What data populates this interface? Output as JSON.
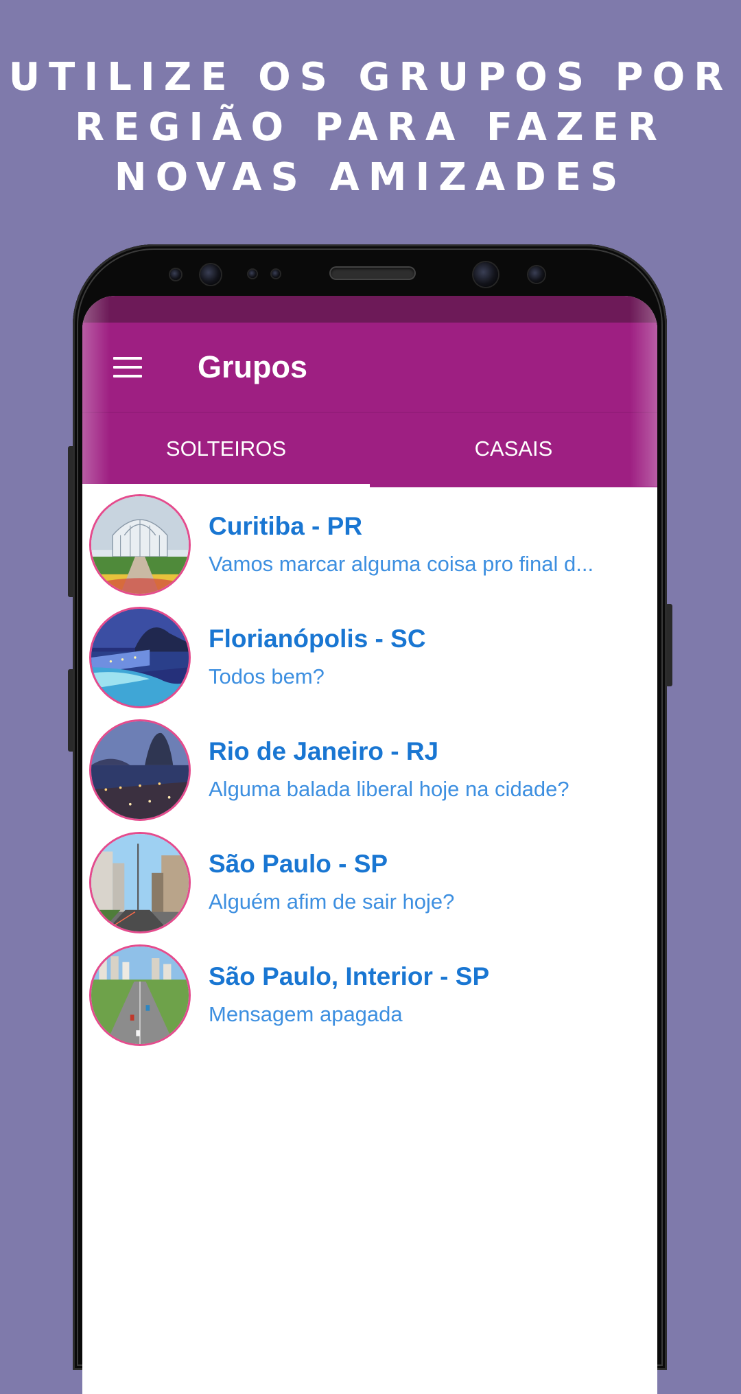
{
  "headline": {
    "line1": "UTILIZE OS GRUPOS POR",
    "line2": "REGIÃO PARA FAZER",
    "line3": "NOVAS AMIZADES"
  },
  "app_bar": {
    "title": "Grupos",
    "menu_icon": "hamburger-menu-icon"
  },
  "tabs": [
    {
      "label": "SOLTEIROS",
      "active": true
    },
    {
      "label": "CASAIS",
      "active": false
    }
  ],
  "groups": [
    {
      "name": "Curitiba - PR",
      "last_message": "Vamos marcar alguma coisa pro final d..."
    },
    {
      "name": "Florianópolis - SC",
      "last_message": "Todos bem?"
    },
    {
      "name": "Rio de Janeiro - RJ",
      "last_message": "Alguma balada liberal hoje na cidade?"
    },
    {
      "name": "São Paulo - SP",
      "last_message": "Alguém afim de sair hoje?"
    },
    {
      "name": "São Paulo, Interior - SP",
      "last_message": "Mensagem apagada"
    }
  ],
  "colors": {
    "background": "#7f7aab",
    "app_bar": "#9e1f82",
    "status_bar": "#6d1a58",
    "group_name": "#1976d2",
    "group_message": "#3d8fe0",
    "avatar_border": "#e44b8d"
  }
}
